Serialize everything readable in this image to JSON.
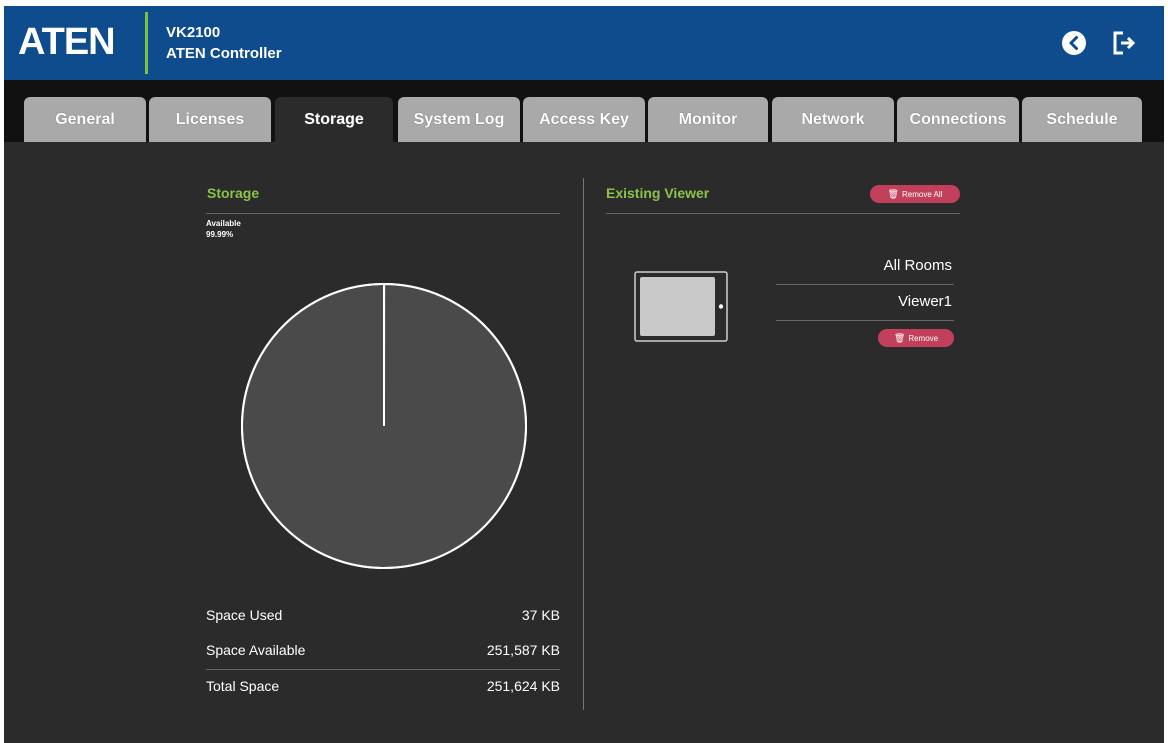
{
  "header": {
    "logo": "ATEN",
    "device_model": "VK2100",
    "device_title": "ATEN Controller"
  },
  "tabs": [
    {
      "label": "General"
    },
    {
      "label": "Licenses"
    },
    {
      "label": "Storage",
      "active": true
    },
    {
      "label": "System Log"
    },
    {
      "label": "Access Key"
    },
    {
      "label": "Monitor"
    },
    {
      "label": "Network"
    },
    {
      "label": "Connections"
    },
    {
      "label": "Schedule"
    }
  ],
  "storage": {
    "title": "Storage",
    "available_label": "Available",
    "available_percent": "99.99%",
    "rows": [
      {
        "label": "Space Used",
        "value": "37 KB"
      },
      {
        "label": "Space Available",
        "value": "251,587 KB"
      },
      {
        "label": "Total Space",
        "value": "251,624 KB"
      }
    ]
  },
  "chart_data": {
    "type": "pie",
    "categories": [
      "Space Used",
      "Space Available"
    ],
    "values": [
      37,
      251587
    ],
    "unit": "KB"
  },
  "viewer": {
    "title": "Existing Viewer",
    "remove_all_label": "Remove All",
    "room": "All Rooms",
    "name": "Viewer1",
    "remove_label": "Remove"
  },
  "colors": {
    "header_bg": "#0f4c8d",
    "accent_green": "#8bc34a",
    "panel_bg": "#2b2b2b",
    "remove_button": "#c2405c"
  }
}
